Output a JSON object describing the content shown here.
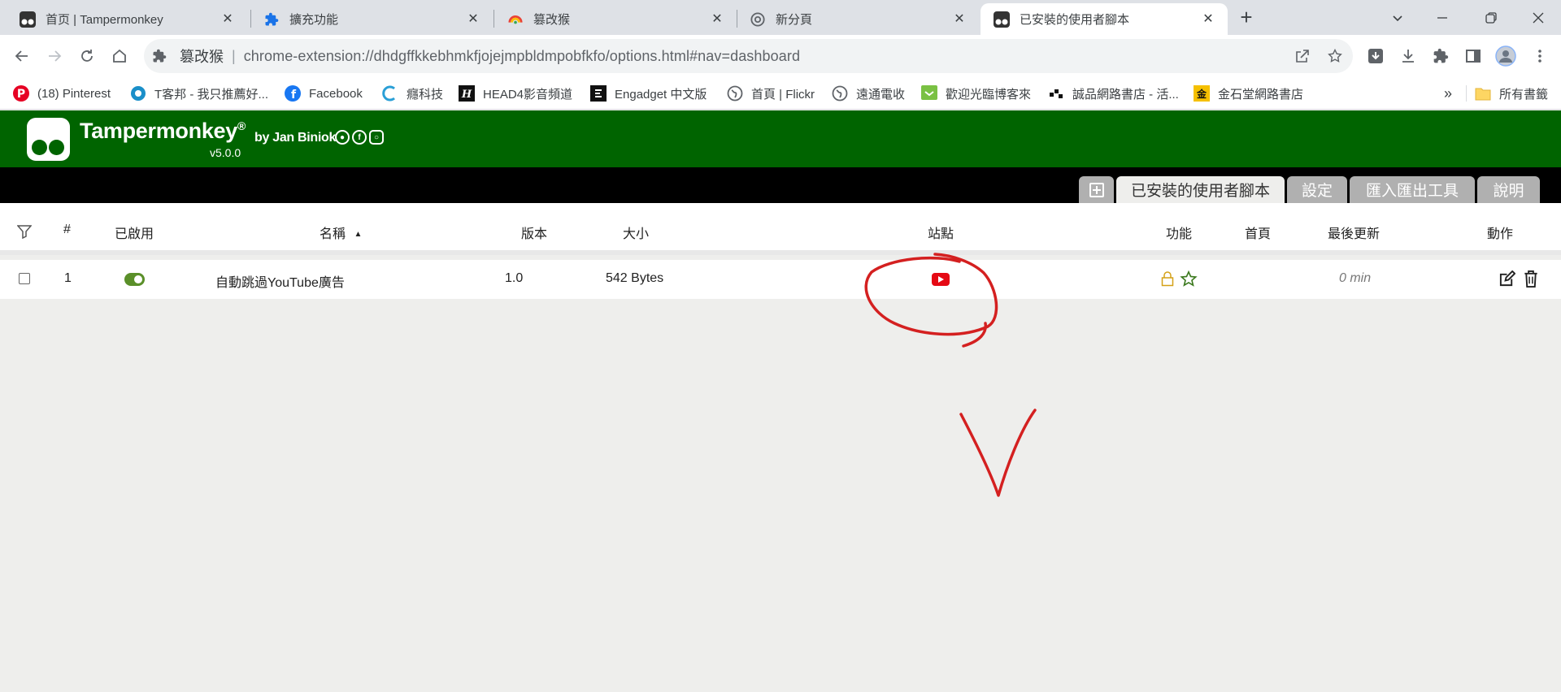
{
  "browser": {
    "tabs": [
      {
        "title": "首页 | Tampermonkey",
        "favicon": "tampermonkey-icon",
        "active": false
      },
      {
        "title": "擴充功能",
        "favicon": "puzzle-icon",
        "active": false
      },
      {
        "title": "篡改猴",
        "favicon": "webstore-icon",
        "active": false
      },
      {
        "title": "新分頁",
        "favicon": "chrome-icon",
        "active": false
      },
      {
        "title": "已安裝的使用者腳本",
        "favicon": "tampermonkey-icon",
        "active": true
      }
    ],
    "omnibox": {
      "site_name": "篡改猴",
      "separator": "|",
      "url": "chrome-extension://dhdgffkkebhmkfjojejmpbldmpobfkfo/options.html#nav=dashboard"
    },
    "bookmarks": [
      {
        "label": "(18) Pinterest",
        "icon": "pinterest-icon",
        "color": "#e60023"
      },
      {
        "label": "T客邦 - 我只推薦好...",
        "icon": "tkb-icon",
        "color": "#1a8fc9"
      },
      {
        "label": "Facebook",
        "icon": "facebook-icon",
        "color": "#1877f2"
      },
      {
        "label": "癮科技",
        "icon": "cool3c-icon",
        "color": "#2a9fd6"
      },
      {
        "label": "HEAD4影音頻道",
        "icon": "head4-icon",
        "color": "#111111"
      },
      {
        "label": "Engadget 中文版",
        "icon": "engadget-icon",
        "color": "#111111"
      },
      {
        "label": "首頁 | Flickr",
        "icon": "globe-icon",
        "color": "#5f6368"
      },
      {
        "label": "遠通電收",
        "icon": "globe-icon",
        "color": "#5f6368"
      },
      {
        "label": "歡迎光臨博客來",
        "icon": "books-icon",
        "color": "#7ac143"
      },
      {
        "label": "誠品網路書店 - 活...",
        "icon": "eslite-icon",
        "color": "#111111"
      },
      {
        "label": "金石堂網路書店",
        "icon": "kingstone-icon",
        "color": "#f5c000"
      }
    ],
    "bookmarks_overflow": "»",
    "all_bookmarks": "所有書籤"
  },
  "tampermonkey": {
    "brand": "Tampermonkey",
    "registered": "®",
    "by": "by Jan Biniok",
    "version": "v5.0.0",
    "brand_color": "#006400"
  },
  "nav": {
    "tabs": [
      {
        "label": "已安裝的使用者腳本",
        "active": true
      },
      {
        "label": "設定",
        "active": false
      },
      {
        "label": "匯入匯出工具",
        "active": false
      },
      {
        "label": "說明",
        "active": false
      }
    ]
  },
  "table": {
    "headers": {
      "num": "#",
      "enabled": "已啟用",
      "name": "名稱",
      "sort_indicator": "▲",
      "version": "版本",
      "size": "大小",
      "sites": "站點",
      "features": "功能",
      "homepage": "首頁",
      "last_updated": "最後更新",
      "actions": "動作"
    },
    "rows": [
      {
        "num": "1",
        "enabled": true,
        "name": "自動跳過YouTube廣告",
        "version": "1.0",
        "size": "542 Bytes",
        "site_icon": "youtube-icon",
        "features": [
          "lock-icon",
          "star-icon"
        ],
        "last_updated": "0 min",
        "actions": [
          "edit-icon",
          "trash-icon"
        ]
      }
    ]
  },
  "annotation_color": "#d42020"
}
